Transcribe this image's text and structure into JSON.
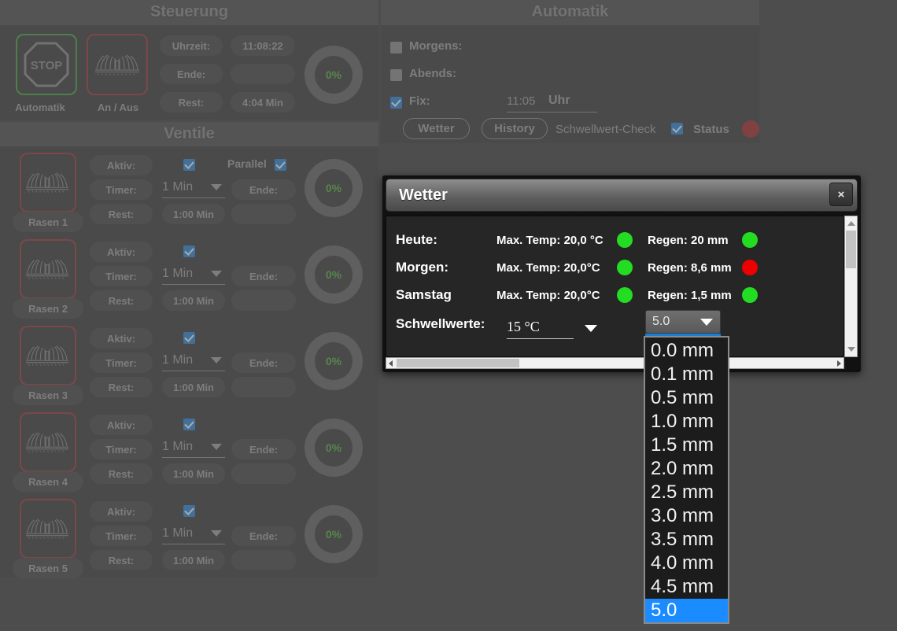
{
  "colors": {
    "bg": "#4d4d4d",
    "panel": "#4a4a4a",
    "panel_header": "#5a5a5a",
    "accent_blue": "#1a8cff",
    "green_ok": "#22dd22",
    "red_alert": "#ee0000",
    "green_text": "#5ea84f",
    "status_red": "#a03a3a"
  },
  "steuerung": {
    "title": "Steuerung",
    "automatik_button_label": "Automatik",
    "automatik_icon": "stop-sign-icon",
    "onoff_button_label": "An / Aus",
    "onoff_icon": "sprinkler-icon",
    "fields": [
      {
        "label": "Uhrzeit:",
        "value": "11:08:22"
      },
      {
        "label": "Ende:",
        "value": ""
      },
      {
        "label": "Rest:",
        "value": "4:04 Min"
      }
    ],
    "progress": "0%"
  },
  "ventile": {
    "title": "Ventile",
    "labels": {
      "aktiv": "Aktiv:",
      "timer": "Timer:",
      "rest": "Rest:",
      "ende": "Ende:",
      "parallel": "Parallel"
    },
    "parallel_checked": true,
    "rows": [
      {
        "name": "Rasen 1",
        "icon": "sprinkler-icon",
        "aktiv": true,
        "timer": "1 Min",
        "rest": "1:00 Min",
        "ende": "",
        "progress": "0%"
      },
      {
        "name": "Rasen 2",
        "icon": "sprinkler-icon",
        "aktiv": true,
        "timer": "1 Min",
        "rest": "1:00 Min",
        "ende": "",
        "progress": "0%"
      },
      {
        "name": "Rasen 3",
        "icon": "sprinkler-icon",
        "aktiv": true,
        "timer": "1 Min",
        "rest": "1:00 Min",
        "ende": "",
        "progress": "0%"
      },
      {
        "name": "Rasen 4",
        "icon": "sprinkler-icon",
        "aktiv": true,
        "timer": "1 Min",
        "rest": "1:00 Min",
        "ende": "",
        "progress": "0%"
      },
      {
        "name": "Rasen 5",
        "icon": "sprinkler-icon",
        "aktiv": true,
        "timer": "1 Min",
        "rest": "1:00 Min",
        "ende": "",
        "progress": "0%"
      }
    ]
  },
  "automatik": {
    "title": "Automatik",
    "morgens_label": "Morgens:",
    "morgens_checked": false,
    "abends_label": "Abends:",
    "abends_checked": false,
    "fix_label": "Fix:",
    "fix_checked": true,
    "fix_time": "11:05",
    "fix_unit": "Uhr",
    "wetter_button": "Wetter",
    "history_button": "History",
    "schwellwert_check_label": "Schwellwert-Check",
    "schwellwert_checked": true,
    "status_label": "Status",
    "status_color": "#a03a3a"
  },
  "modal": {
    "title": "Wetter",
    "close_label": "×",
    "forecast": [
      {
        "day": "Heute:",
        "temp": "Max. Temp: 20,0 °C",
        "temp_state": "green",
        "rain": "Regen: 20 mm",
        "rain_state": "green"
      },
      {
        "day": "Morgen:",
        "temp": "Max. Temp: 20,0°C",
        "temp_state": "green",
        "rain": "Regen: 8,6 mm",
        "rain_state": "red"
      },
      {
        "day": "Samstag",
        "temp": "Max. Temp: 20,0°C",
        "temp_state": "green",
        "rain": "Regen: 1,5 mm",
        "rain_state": "green"
      }
    ],
    "threshold_label": "Schwellwerte:",
    "temp_threshold": "15 °C",
    "rain_threshold": "5.0",
    "rain_options": [
      "0.0 mm",
      "0.1 mm",
      "0.5 mm",
      "1.0 mm",
      "1.5 mm",
      "2.0 mm",
      "2.5 mm",
      "3.0 mm",
      "3.5 mm",
      "4.0 mm",
      "4.5 mm",
      "5.0"
    ],
    "selected_option_index": 11
  }
}
